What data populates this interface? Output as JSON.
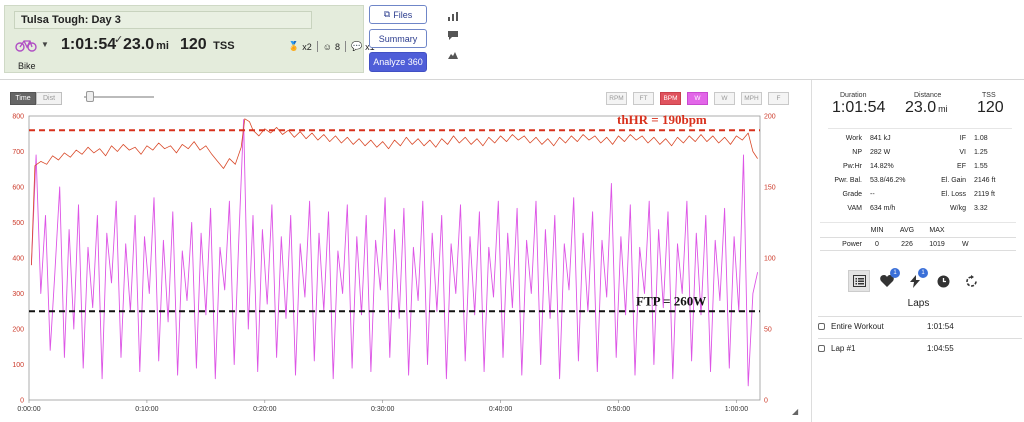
{
  "workout": {
    "title": "Tulsa Tough: Day 3",
    "sport": "Bike",
    "duration": "1:01:54",
    "distance": "23.0",
    "distance_unit": "mi",
    "tss": "120",
    "tss_unit": "TSS",
    "badges": [
      {
        "icon": "medal-icon",
        "text": "x2"
      },
      {
        "icon": "smiley-icon",
        "text": "8"
      },
      {
        "icon": "comments-icon",
        "text": "x1"
      }
    ]
  },
  "buttons": {
    "files": "Files",
    "summary": "Summary",
    "analyze": "Analyze 360"
  },
  "chart_toolbar": {
    "time": "Time",
    "dist": "Dist",
    "channels": [
      "RPM",
      "FT",
      "BPM",
      "W",
      "W",
      "MPH",
      "F"
    ],
    "active_channels": [
      2,
      3
    ]
  },
  "colors": {
    "power": "#dd55e6",
    "heart_rate": "#d94a2a",
    "active_red": "#e0535e",
    "active_magenta": "#e266e8",
    "primary_button": "#4f5ed8",
    "card_bg": "#e4ecdc"
  },
  "chart_data": {
    "type": "line",
    "x_axis": {
      "label": "",
      "ticks": [
        "0:00:00",
        "0:10:00",
        "0:20:00",
        "0:30:00",
        "0:40:00",
        "0:50:00",
        "1:00:00"
      ],
      "range_minutes": [
        0,
        62
      ]
    },
    "y_left": {
      "range": [
        0,
        800
      ],
      "ticks": [
        0,
        100,
        200,
        300,
        400,
        500,
        600,
        700,
        800
      ]
    },
    "y_right": {
      "range": [
        0,
        200
      ],
      "ticks": [
        0,
        50,
        100,
        150,
        200
      ]
    },
    "series": [
      {
        "key": "power",
        "axis": "left",
        "points": [
          [
            0.2,
            380
          ],
          [
            0.6,
            690
          ],
          [
            1.0,
            300
          ],
          [
            1.4,
            520
          ],
          [
            1.8,
            140
          ],
          [
            2.2,
            360
          ],
          [
            2.6,
            600
          ],
          [
            3.0,
            120
          ],
          [
            3.4,
            480
          ],
          [
            3.8,
            200
          ],
          [
            4.2,
            550
          ],
          [
            4.6,
            90
          ],
          [
            5.0,
            430
          ],
          [
            5.4,
            260
          ],
          [
            5.8,
            520
          ],
          [
            6.2,
            60
          ],
          [
            6.6,
            470
          ],
          [
            7.0,
            330
          ],
          [
            7.4,
            560
          ],
          [
            7.8,
            120
          ],
          [
            8.2,
            440
          ],
          [
            8.6,
            250
          ],
          [
            9.0,
            520
          ],
          [
            9.4,
            80
          ],
          [
            9.8,
            460
          ],
          [
            10.2,
            300
          ],
          [
            10.6,
            570
          ],
          [
            11.0,
            110
          ],
          [
            11.4,
            450
          ],
          [
            11.8,
            220
          ],
          [
            12.2,
            530
          ],
          [
            12.6,
            70
          ],
          [
            13.0,
            420
          ],
          [
            13.4,
            280
          ],
          [
            13.8,
            500
          ],
          [
            14.2,
            90
          ],
          [
            14.6,
            470
          ],
          [
            15.0,
            240
          ],
          [
            15.4,
            540
          ],
          [
            15.8,
            60
          ],
          [
            16.2,
            430
          ],
          [
            16.6,
            310
          ],
          [
            17.0,
            560
          ],
          [
            17.4,
            100
          ],
          [
            17.8,
            460
          ],
          [
            18.2,
            790
          ],
          [
            18.6,
            200
          ],
          [
            19.0,
            520
          ],
          [
            19.4,
            80
          ],
          [
            19.8,
            480
          ],
          [
            20.2,
            270
          ],
          [
            20.6,
            550
          ],
          [
            21.0,
            120
          ],
          [
            21.4,
            460
          ],
          [
            21.8,
            230
          ],
          [
            22.2,
            520
          ],
          [
            22.6,
            70
          ],
          [
            23.0,
            440
          ],
          [
            23.4,
            290
          ],
          [
            23.8,
            560
          ],
          [
            24.2,
            110
          ],
          [
            24.6,
            470
          ],
          [
            25.0,
            250
          ],
          [
            25.4,
            530
          ],
          [
            25.8,
            60
          ],
          [
            26.2,
            420
          ],
          [
            26.6,
            300
          ],
          [
            27.0,
            550
          ],
          [
            27.4,
            90
          ],
          [
            27.8,
            460
          ],
          [
            28.2,
            240
          ],
          [
            28.6,
            520
          ],
          [
            29.0,
            80
          ],
          [
            29.4,
            450
          ],
          [
            29.8,
            310
          ],
          [
            30.2,
            570
          ],
          [
            30.6,
            120
          ],
          [
            31.0,
            480
          ],
          [
            31.4,
            230
          ],
          [
            31.8,
            540
          ],
          [
            32.2,
            70
          ],
          [
            32.6,
            430
          ],
          [
            33.0,
            280
          ],
          [
            33.4,
            560
          ],
          [
            33.8,
            100
          ],
          [
            34.2,
            470
          ],
          [
            34.6,
            250
          ],
          [
            35.0,
            520
          ],
          [
            35.4,
            60
          ],
          [
            35.8,
            440
          ],
          [
            36.2,
            300
          ],
          [
            36.6,
            550
          ],
          [
            37.0,
            110
          ],
          [
            37.4,
            460
          ],
          [
            37.8,
            240
          ],
          [
            38.2,
            530
          ],
          [
            38.6,
            80
          ],
          [
            39.0,
            430
          ],
          [
            39.4,
            290
          ],
          [
            39.8,
            560
          ],
          [
            40.2,
            120
          ],
          [
            40.6,
            470
          ],
          [
            41.0,
            260
          ],
          [
            41.4,
            540
          ],
          [
            41.8,
            70
          ],
          [
            42.2,
            450
          ],
          [
            42.6,
            300
          ],
          [
            43.0,
            560
          ],
          [
            43.4,
            100
          ],
          [
            43.8,
            480
          ],
          [
            44.2,
            230
          ],
          [
            44.6,
            520
          ],
          [
            45.0,
            60
          ],
          [
            45.4,
            440
          ],
          [
            45.8,
            310
          ],
          [
            46.2,
            570
          ],
          [
            46.6,
            110
          ],
          [
            47.0,
            470
          ],
          [
            47.4,
            250
          ],
          [
            47.8,
            530
          ],
          [
            48.2,
            80
          ],
          [
            48.6,
            450
          ],
          [
            49.0,
            290
          ],
          [
            49.4,
            610
          ],
          [
            49.8,
            120
          ],
          [
            50.2,
            460
          ],
          [
            50.6,
            240
          ],
          [
            51.0,
            550
          ],
          [
            51.4,
            70
          ],
          [
            51.8,
            430
          ],
          [
            52.2,
            300
          ],
          [
            52.6,
            560
          ],
          [
            53.0,
            100
          ],
          [
            53.4,
            480
          ],
          [
            53.8,
            260
          ],
          [
            54.2,
            530
          ],
          [
            54.6,
            60
          ],
          [
            55.0,
            440
          ],
          [
            55.4,
            300
          ],
          [
            55.8,
            560
          ],
          [
            56.2,
            110
          ],
          [
            56.6,
            470
          ],
          [
            57.0,
            240
          ],
          [
            57.4,
            520
          ],
          [
            57.8,
            80
          ],
          [
            58.2,
            450
          ],
          [
            58.6,
            280
          ],
          [
            59.0,
            540
          ],
          [
            59.4,
            90
          ],
          [
            59.8,
            460
          ],
          [
            60.2,
            250
          ],
          [
            60.6,
            690
          ],
          [
            61.0,
            40
          ],
          [
            61.4,
            300
          ],
          [
            61.8,
            360
          ]
        ]
      },
      {
        "key": "heart_rate",
        "axis": "right",
        "points": [
          [
            0.2,
            95
          ],
          [
            0.5,
            165
          ],
          [
            1,
            168
          ],
          [
            1.5,
            166
          ],
          [
            2,
            172
          ],
          [
            2.5,
            169
          ],
          [
            3,
            174
          ],
          [
            3.5,
            171
          ],
          [
            4,
            176
          ],
          [
            4.5,
            173
          ],
          [
            5,
            178
          ],
          [
            5.5,
            174
          ],
          [
            6,
            177
          ],
          [
            6.5,
            172
          ],
          [
            7,
            179
          ],
          [
            7.5,
            175
          ],
          [
            8,
            180
          ],
          [
            8.5,
            176
          ],
          [
            9,
            178
          ],
          [
            9.5,
            173
          ],
          [
            10,
            179
          ],
          [
            10.5,
            176
          ],
          [
            11,
            181
          ],
          [
            11.5,
            177
          ],
          [
            12,
            179
          ],
          [
            12.5,
            174
          ],
          [
            13,
            180
          ],
          [
            13.5,
            177
          ],
          [
            14,
            182
          ],
          [
            14.5,
            176
          ],
          [
            15,
            179
          ],
          [
            15.5,
            173
          ],
          [
            16,
            168
          ],
          [
            16.5,
            163
          ],
          [
            17,
            170
          ],
          [
            17.5,
            166
          ],
          [
            18,
            178
          ],
          [
            18.3,
            198
          ],
          [
            18.7,
            196
          ],
          [
            19,
            190
          ],
          [
            19.5,
            186
          ],
          [
            20,
            191
          ],
          [
            20.5,
            188
          ],
          [
            21,
            192
          ],
          [
            21.5,
            187
          ],
          [
            22,
            190
          ],
          [
            22.5,
            185
          ],
          [
            23,
            189
          ],
          [
            23.5,
            184
          ],
          [
            24,
            188
          ],
          [
            24.5,
            183
          ],
          [
            25,
            187
          ],
          [
            25.5,
            182
          ],
          [
            26,
            186
          ],
          [
            26.5,
            181
          ],
          [
            27,
            185
          ],
          [
            27.5,
            180
          ],
          [
            28,
            184
          ],
          [
            28.5,
            179
          ],
          [
            29,
            183
          ],
          [
            29.5,
            178
          ],
          [
            30,
            182
          ],
          [
            30.5,
            177
          ],
          [
            31,
            183
          ],
          [
            31.5,
            179
          ],
          [
            32,
            185
          ],
          [
            32.5,
            180
          ],
          [
            33,
            184
          ],
          [
            33.5,
            179
          ],
          [
            34,
            183
          ],
          [
            34.5,
            178
          ],
          [
            35,
            184
          ],
          [
            35.5,
            180
          ],
          [
            36,
            186
          ],
          [
            36.5,
            181
          ],
          [
            37,
            185
          ],
          [
            37.5,
            180
          ],
          [
            38,
            184
          ],
          [
            38.5,
            179
          ],
          [
            39,
            185
          ],
          [
            39.5,
            181
          ],
          [
            40,
            186
          ],
          [
            40.5,
            182
          ],
          [
            41,
            187
          ],
          [
            41.5,
            183
          ],
          [
            42,
            186
          ],
          [
            42.5,
            181
          ],
          [
            43,
            185
          ],
          [
            43.5,
            180
          ],
          [
            44,
            184
          ],
          [
            44.5,
            179
          ],
          [
            45,
            185
          ],
          [
            45.5,
            181
          ],
          [
            46,
            186
          ],
          [
            46.5,
            182
          ],
          [
            47,
            187
          ],
          [
            47.5,
            183
          ],
          [
            48,
            186
          ],
          [
            48.5,
            181
          ],
          [
            49,
            185
          ],
          [
            49.5,
            180
          ],
          [
            50,
            186
          ],
          [
            50.5,
            182
          ],
          [
            51,
            187
          ],
          [
            51.5,
            183
          ],
          [
            52,
            186
          ],
          [
            52.5,
            181
          ],
          [
            53,
            185
          ],
          [
            53.5,
            180
          ],
          [
            54,
            184
          ],
          [
            54.5,
            179
          ],
          [
            55,
            185
          ],
          [
            55.5,
            181
          ],
          [
            56,
            186
          ],
          [
            56.5,
            182
          ],
          [
            57,
            187
          ],
          [
            57.5,
            182
          ],
          [
            58,
            186
          ],
          [
            58.5,
            181
          ],
          [
            59,
            185
          ],
          [
            59.5,
            180
          ],
          [
            60,
            186
          ],
          [
            60.5,
            183
          ],
          [
            61,
            188
          ],
          [
            61.4,
            175
          ],
          [
            61.8,
            170
          ]
        ]
      }
    ],
    "threshold_lines": [
      {
        "label": "thHR = 190bpm",
        "axis": "right",
        "value": 190,
        "color": "#d8301c"
      },
      {
        "label": "FTP = 260W",
        "axis": "left",
        "value": 250,
        "color": "#111111"
      }
    ]
  },
  "summary": {
    "duration_label": "Duration",
    "duration": "1:01:54",
    "distance_label": "Distance",
    "distance": "23.0",
    "distance_unit": "mi",
    "tss_label": "TSS",
    "tss": "120",
    "stats": [
      [
        "Work",
        "841 kJ",
        "IF",
        "1.08"
      ],
      [
        "NP",
        "282 W",
        "VI",
        "1.25"
      ],
      [
        "Pw:Hr",
        "14.82%",
        "EF",
        "1.55"
      ],
      [
        "Pwr. Bal.",
        "53.8/46.2%",
        "El. Gain",
        "2146 ft"
      ],
      [
        "Grade",
        "--",
        "El. Loss",
        "2119 ft"
      ],
      [
        "VAM",
        "634 m/h",
        "W/kg",
        "3.32"
      ]
    ]
  },
  "minmax": {
    "headers": [
      "MIN",
      "AVG",
      "MAX"
    ],
    "row_label": "Power",
    "values": [
      "0",
      "226",
      "1019"
    ],
    "unit": "W"
  },
  "panel_icons": {
    "badges": [
      "1",
      "1"
    ]
  },
  "laps": {
    "title": "Laps",
    "items": [
      {
        "name": "Entire Workout",
        "time": "1:01:54"
      },
      {
        "name": "Lap #1",
        "time": "1:04:55"
      }
    ]
  }
}
